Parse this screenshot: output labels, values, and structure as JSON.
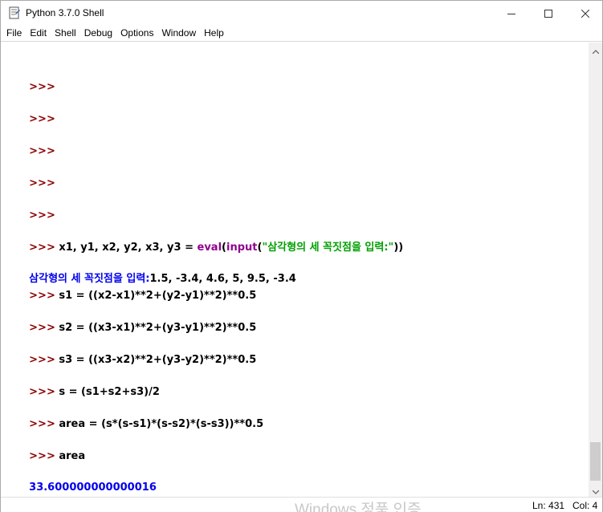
{
  "window": {
    "title": "Python 3.7.0 Shell",
    "app_icon": "python-idle-icon"
  },
  "menubar": {
    "items": [
      "File",
      "Edit",
      "Shell",
      "Debug",
      "Options",
      "Window",
      "Help"
    ]
  },
  "shell": {
    "prompt": ">>>",
    "lines": [
      {
        "kind": "prompt",
        "code": ""
      },
      {
        "kind": "prompt",
        "code": ""
      },
      {
        "kind": "prompt",
        "code": ""
      },
      {
        "kind": "prompt",
        "code": ""
      },
      {
        "kind": "prompt",
        "code": ""
      },
      {
        "kind": "prompt",
        "code_pre": " x1, y1, x2, y2, x3, y3 = ",
        "builtin1": "eval",
        "paren1": "(",
        "builtin2": "input",
        "paren2": "(",
        "string": "\"삼각형의 세 꼭짓점을 입력:\"",
        "code_post": "))"
      },
      {
        "kind": "stdout",
        "text": "삼각형의 세 꼭짓점을 입력:",
        "input": "1.5, -3.4, 4.6, 5, 9.5, -3.4"
      },
      {
        "kind": "prompt",
        "code": " s1 = ((x2-x1)**2+(y2-y1)**2)**0.5"
      },
      {
        "kind": "prompt",
        "code": " s2 = ((x3-x1)**2+(y3-y1)**2)**0.5"
      },
      {
        "kind": "prompt",
        "code": " s3 = ((x3-x2)**2+(y3-y2)**2)**0.5"
      },
      {
        "kind": "prompt",
        "code": " s = (s1+s2+s3)/2"
      },
      {
        "kind": "prompt",
        "code": " area = (s*(s-s1)*(s-s2)*(s-s3))**0.5"
      },
      {
        "kind": "prompt",
        "code": " area"
      },
      {
        "kind": "output",
        "text": "33.600000000000016"
      },
      {
        "kind": "prompt",
        "code": ""
      }
    ]
  },
  "statusbar": {
    "watermark": "Windows 정품 인증",
    "ln": "Ln: 431",
    "col": "Col: 4"
  },
  "colors": {
    "prompt": "#8b0000",
    "builtin": "#900090",
    "string": "#00a000",
    "stdout": "#0000ee"
  }
}
